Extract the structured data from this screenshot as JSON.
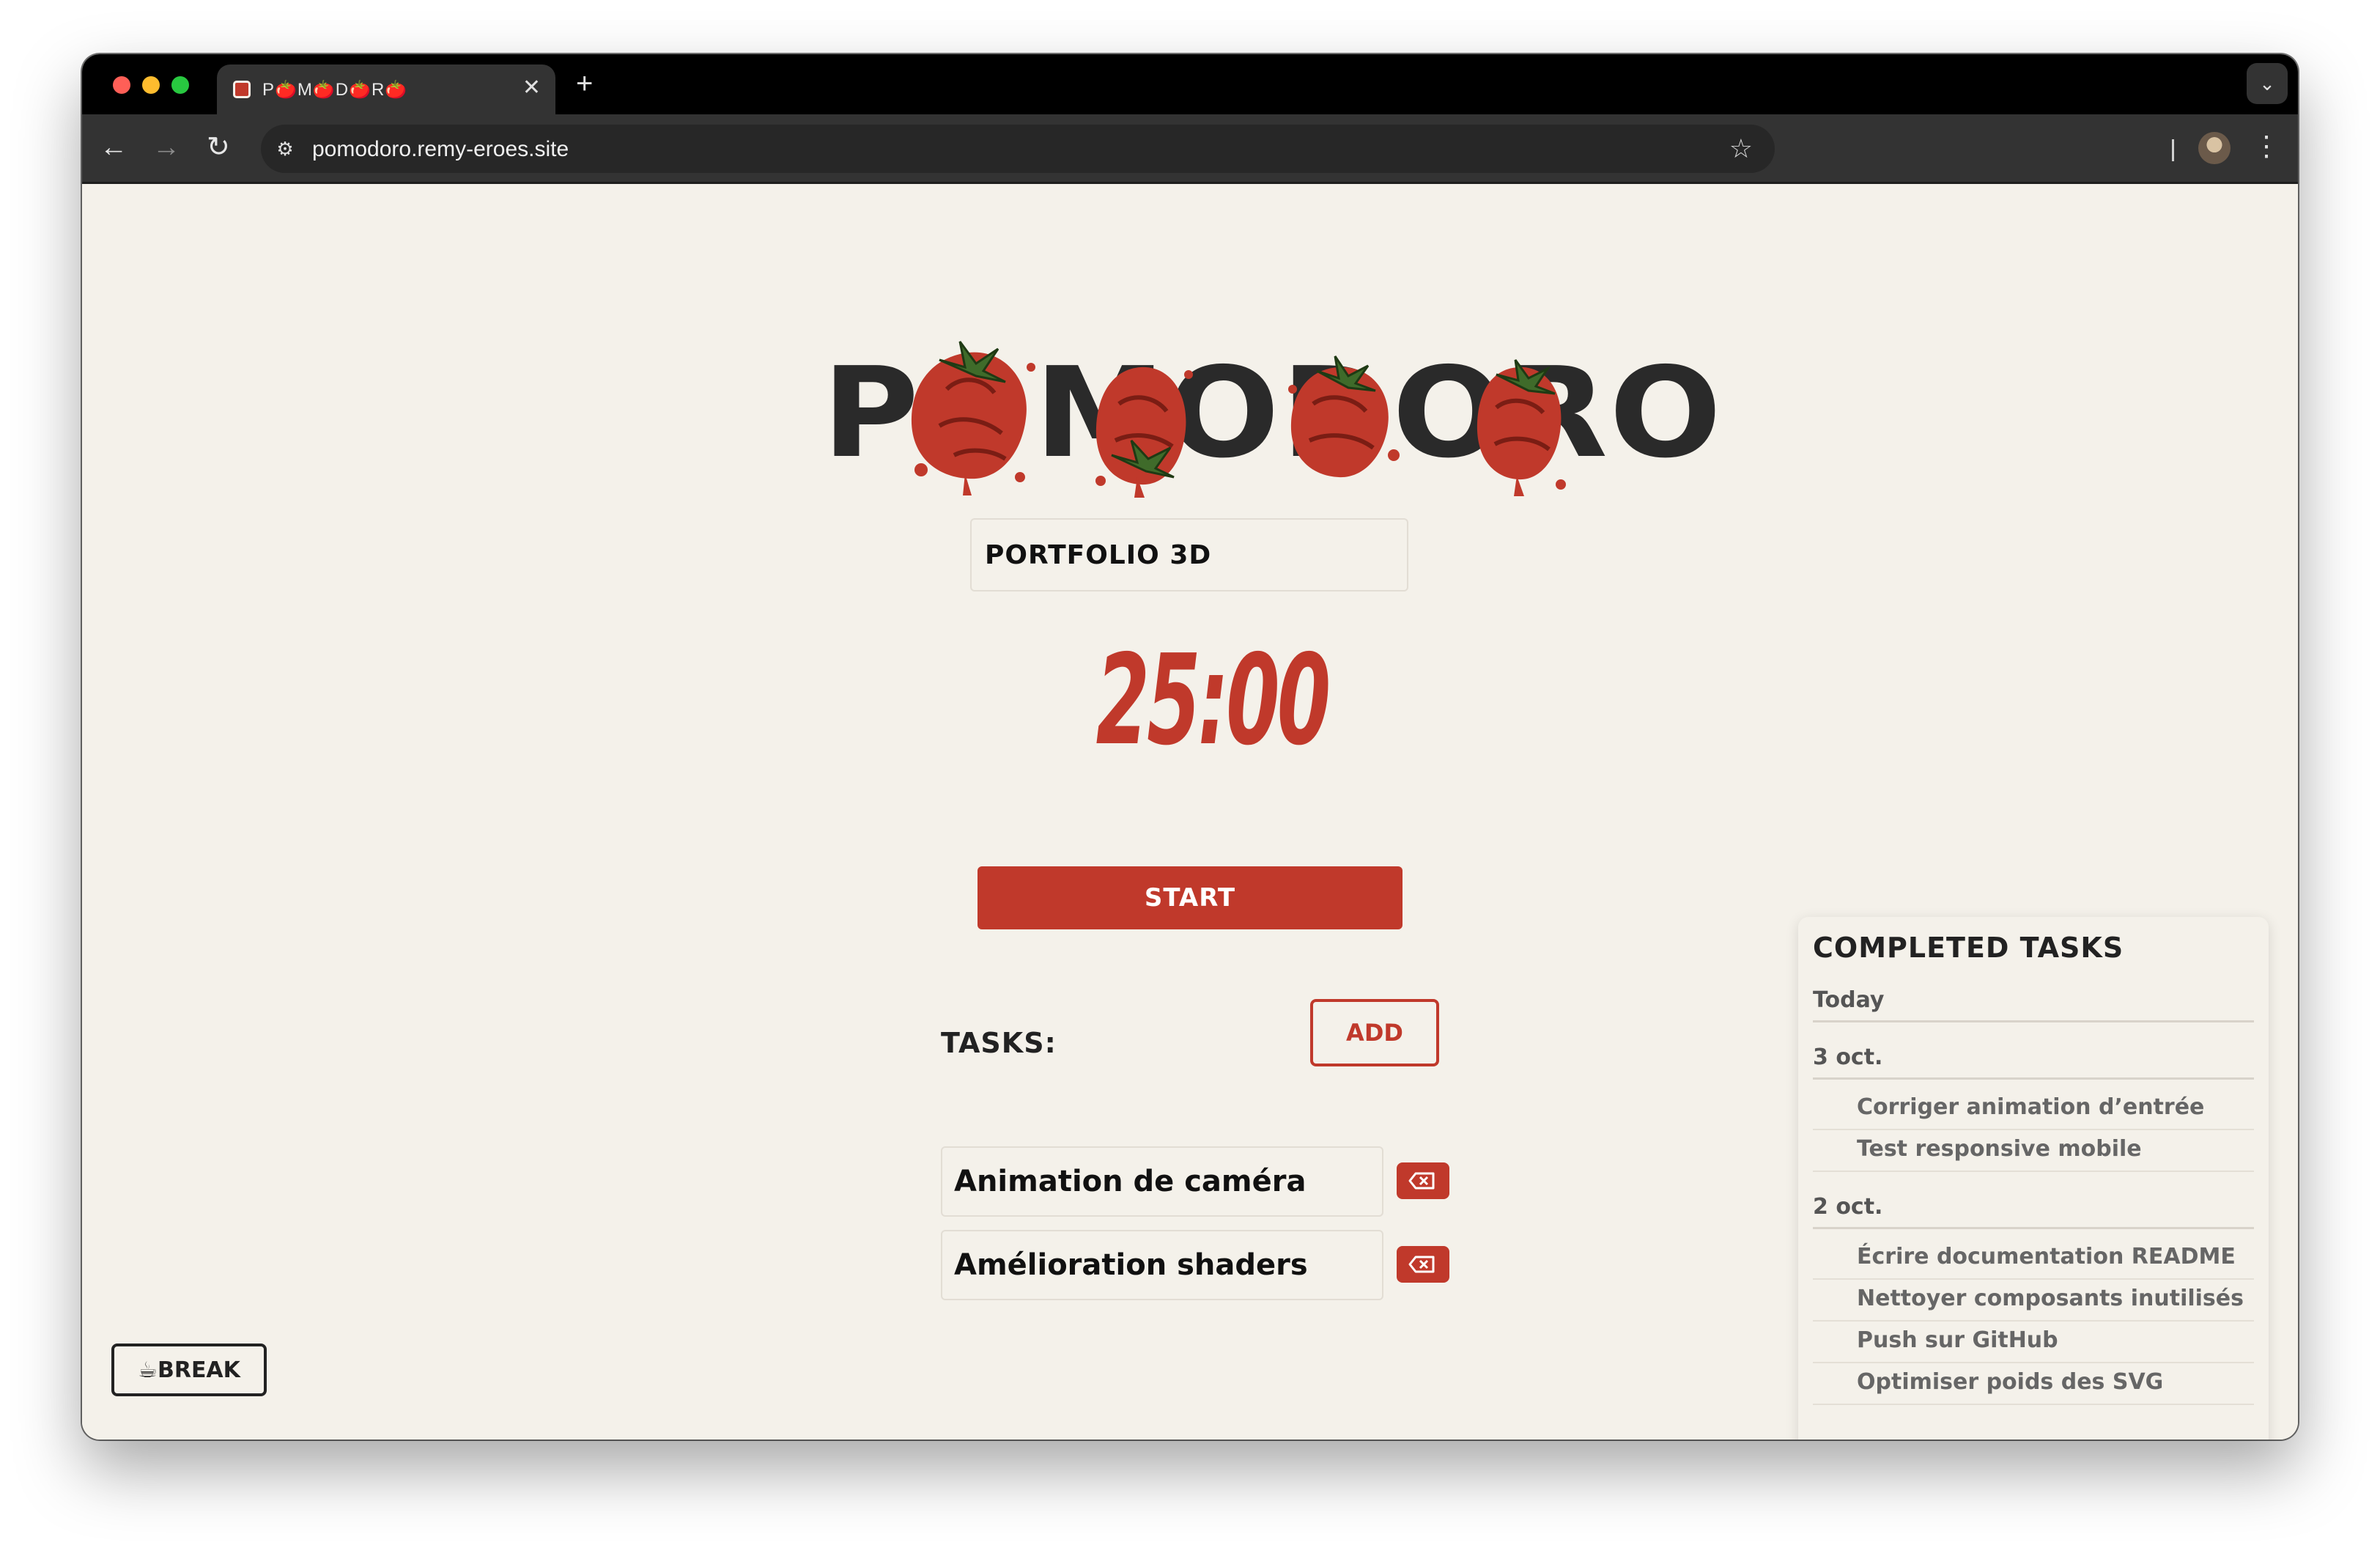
{
  "browser": {
    "tab_title": "P🍅M🍅D🍅R🍅",
    "tab_close": "✕",
    "new_tab": "+",
    "tab_search": "⌄",
    "url": "pomodoro.remy-eroes.site",
    "icons": [
      "back-icon",
      "forward-icon",
      "reload-icon",
      "site-settings-icon",
      "bookmark-star-icon",
      "profile-avatar",
      "more-menu-icon"
    ]
  },
  "app": {
    "logo_text": "POMODORO",
    "project_name": "PORTFOLIO 3D",
    "timer": "25:00",
    "start_label": "START",
    "tasks_label": "TASKS:",
    "add_label": "ADD",
    "tasks": [
      {
        "text": "Animation de caméra"
      },
      {
        "text": "Amélioration shaders"
      }
    ],
    "break_label": "☕BREAK",
    "colors": {
      "accent": "#c0392b",
      "background": "#f4f1ea",
      "text": "#222222"
    }
  },
  "completed": {
    "title": "COMPLETED TASKS",
    "groups": [
      {
        "label": "Today",
        "items": []
      },
      {
        "label": "3 oct.",
        "items": [
          "Corriger animation d’entrée",
          "Test responsive mobile"
        ]
      },
      {
        "label": "2 oct.",
        "items": [
          "Écrire documentation README",
          "Nettoyer composants inutilisés",
          "Push sur GitHub",
          "Optimiser poids des SVG"
        ]
      }
    ]
  }
}
